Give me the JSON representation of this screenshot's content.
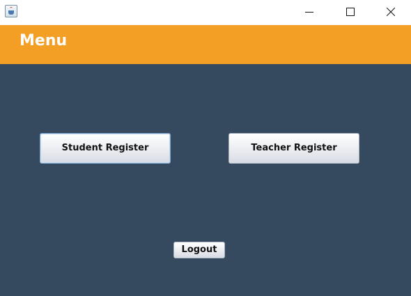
{
  "window": {
    "controls": {
      "minimize_icon": "minimize-icon",
      "maximize_icon": "maximize-icon",
      "close_icon": "close-icon"
    },
    "app_icon": "java-cup-icon"
  },
  "header": {
    "title": "Menu",
    "background": "#f39f26"
  },
  "main": {
    "background": "#364a5f",
    "student_register_label": "Student Register",
    "teacher_register_label": "Teacher Register",
    "logout_label": "Logout"
  }
}
